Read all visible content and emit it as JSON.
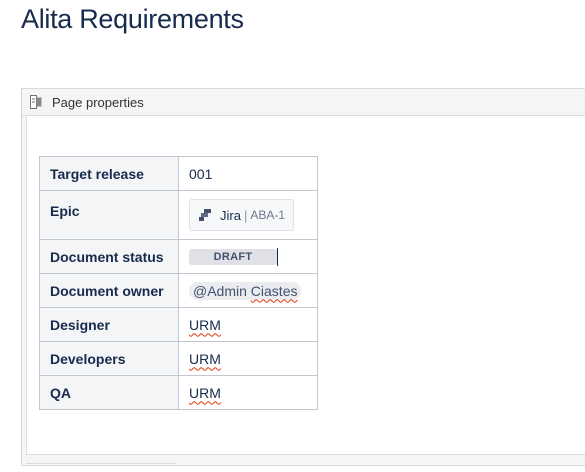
{
  "page": {
    "title": "Alita Requirements"
  },
  "macro": {
    "title": "Page properties",
    "icon": "page-properties-icon"
  },
  "properties": {
    "target_release": {
      "label": "Target release",
      "value": "001"
    },
    "epic": {
      "label": "Epic",
      "product": "Jira",
      "separator": "|",
      "issue_key": "ABA-1",
      "icon": "jira-icon"
    },
    "document_status": {
      "label": "Document status",
      "value": "DRAFT"
    },
    "document_owner": {
      "label": "Document owner",
      "at": "@",
      "first": "Admin",
      "last": "Ciastes"
    },
    "designer": {
      "label": "Designer",
      "value": "URM"
    },
    "developers": {
      "label": "Developers",
      "value": "URM"
    },
    "qa": {
      "label": "QA",
      "value": "URM"
    }
  }
}
